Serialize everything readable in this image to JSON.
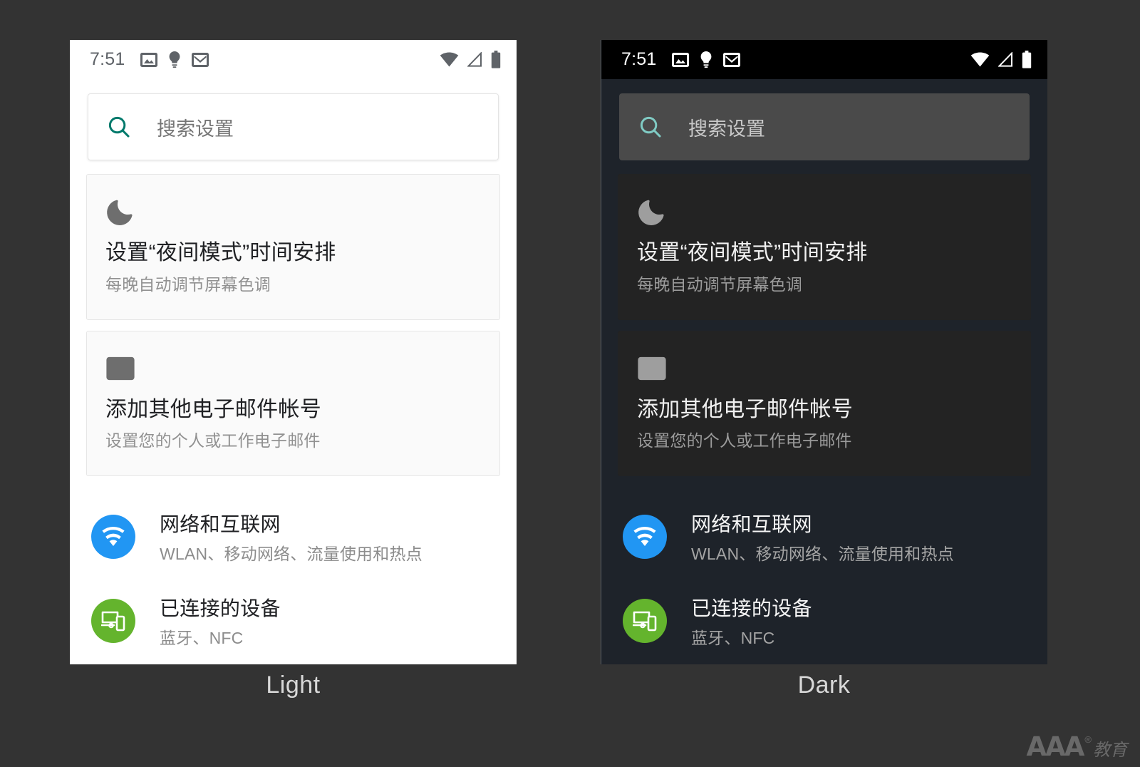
{
  "page": {
    "background_color": "#333333",
    "watermark": {
      "brand": "AAA",
      "registered": "®",
      "cn": "教育"
    }
  },
  "captions": {
    "light": "Light",
    "dark": "Dark"
  },
  "status_bar": {
    "time": "7:51",
    "left_icons": [
      "photos-icon",
      "lightbulb-icon",
      "gmail-icon"
    ],
    "right_icons": [
      "wifi-icon",
      "signal-icon",
      "battery-icon"
    ]
  },
  "search": {
    "placeholder": "搜索设置",
    "icon": "search-icon",
    "accent_light": "#00796b",
    "accent_dark": "#80cbc4"
  },
  "cards": [
    {
      "icon": "moon-icon",
      "title": "设置“夜间模式”时间安排",
      "subtitle": "每晚自动调节屏幕色调"
    },
    {
      "icon": "gmail-icon",
      "title": "添加其他电子邮件帐号",
      "subtitle": "设置您的个人或工作电子邮件"
    }
  ],
  "settings_items": [
    {
      "icon": "wifi-icon",
      "badge_color": "#2196f3",
      "title": "网络和互联网",
      "subtitle": "WLAN、移动网络、流量使用和热点"
    },
    {
      "icon": "connected-devices-icon",
      "badge_color": "#64b42d",
      "title": "已连接的设备",
      "subtitle": "蓝牙、NFC"
    }
  ],
  "themes": {
    "light": {
      "screen_bg": "#ffffff",
      "statusbar_bg": "#ffffff",
      "card_bg": "#fafafa",
      "search_bg": "#ffffff"
    },
    "dark": {
      "screen_bg": "#1e232a",
      "statusbar_bg": "#000000",
      "card_bg": "#232323",
      "search_bg": "#4a4a4a"
    }
  }
}
